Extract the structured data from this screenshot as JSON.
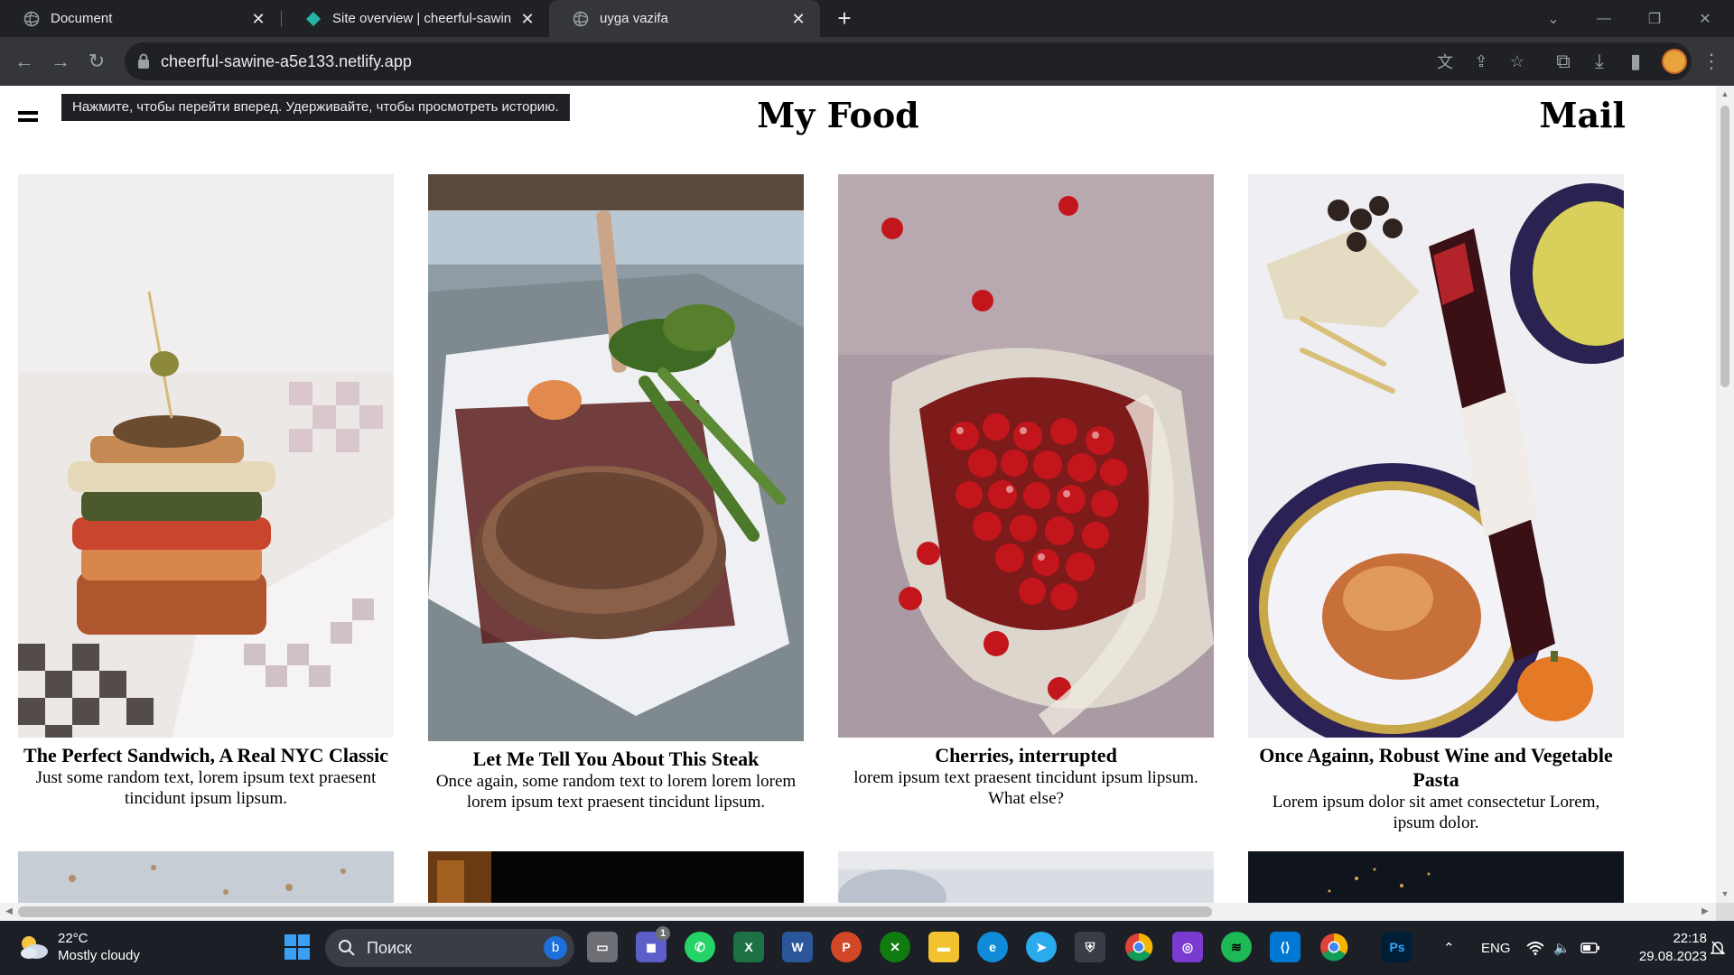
{
  "browser": {
    "tabs": [
      {
        "title": "Document",
        "favicon": "globe-icon",
        "active": false
      },
      {
        "title": "Site overview | cheerful-sawine-a",
        "favicon": "netlify-icon",
        "active": false
      },
      {
        "title": "uyga vazifa",
        "favicon": "globe-icon",
        "active": true
      }
    ],
    "url": "cheerful-sawine-a5e133.netlify.app",
    "tooltip": "Нажмите, чтобы перейти вперед. Удерживайте, чтобы просмотреть историю."
  },
  "page": {
    "brand": "My Food",
    "nav_link": "Mail",
    "cards": [
      {
        "title": "The Perfect Sandwich, A Real NYC Classic",
        "desc": "Just some random text, lorem ipsum text praesent tincidunt ipsum lipsum.",
        "image": "sandwich-photo"
      },
      {
        "title": "Let Me Tell You About This Steak",
        "desc": "Once again, some random text to lorem lorem lorem lorem ipsum text praesent tincidunt lipsum.",
        "image": "steak-photo"
      },
      {
        "title": "Cherries, interrupted",
        "desc": "lorem ipsum text praesent tincidunt ipsum lipsum. What else?",
        "image": "cherries-photo"
      },
      {
        "title": "Once Againn, Robust Wine and Vegetable Pasta",
        "desc": "Lorem ipsum dolor sit amet consectetur Lorem, ipsum dolor.",
        "image": "wine-pasta-photo"
      }
    ]
  },
  "taskbar": {
    "weather": {
      "temp": "22°C",
      "condition": "Mostly cloudy"
    },
    "search_placeholder": "Поиск",
    "language": "ENG",
    "time": "22:18",
    "date": "29.08.2023",
    "chat_badge": "1"
  }
}
